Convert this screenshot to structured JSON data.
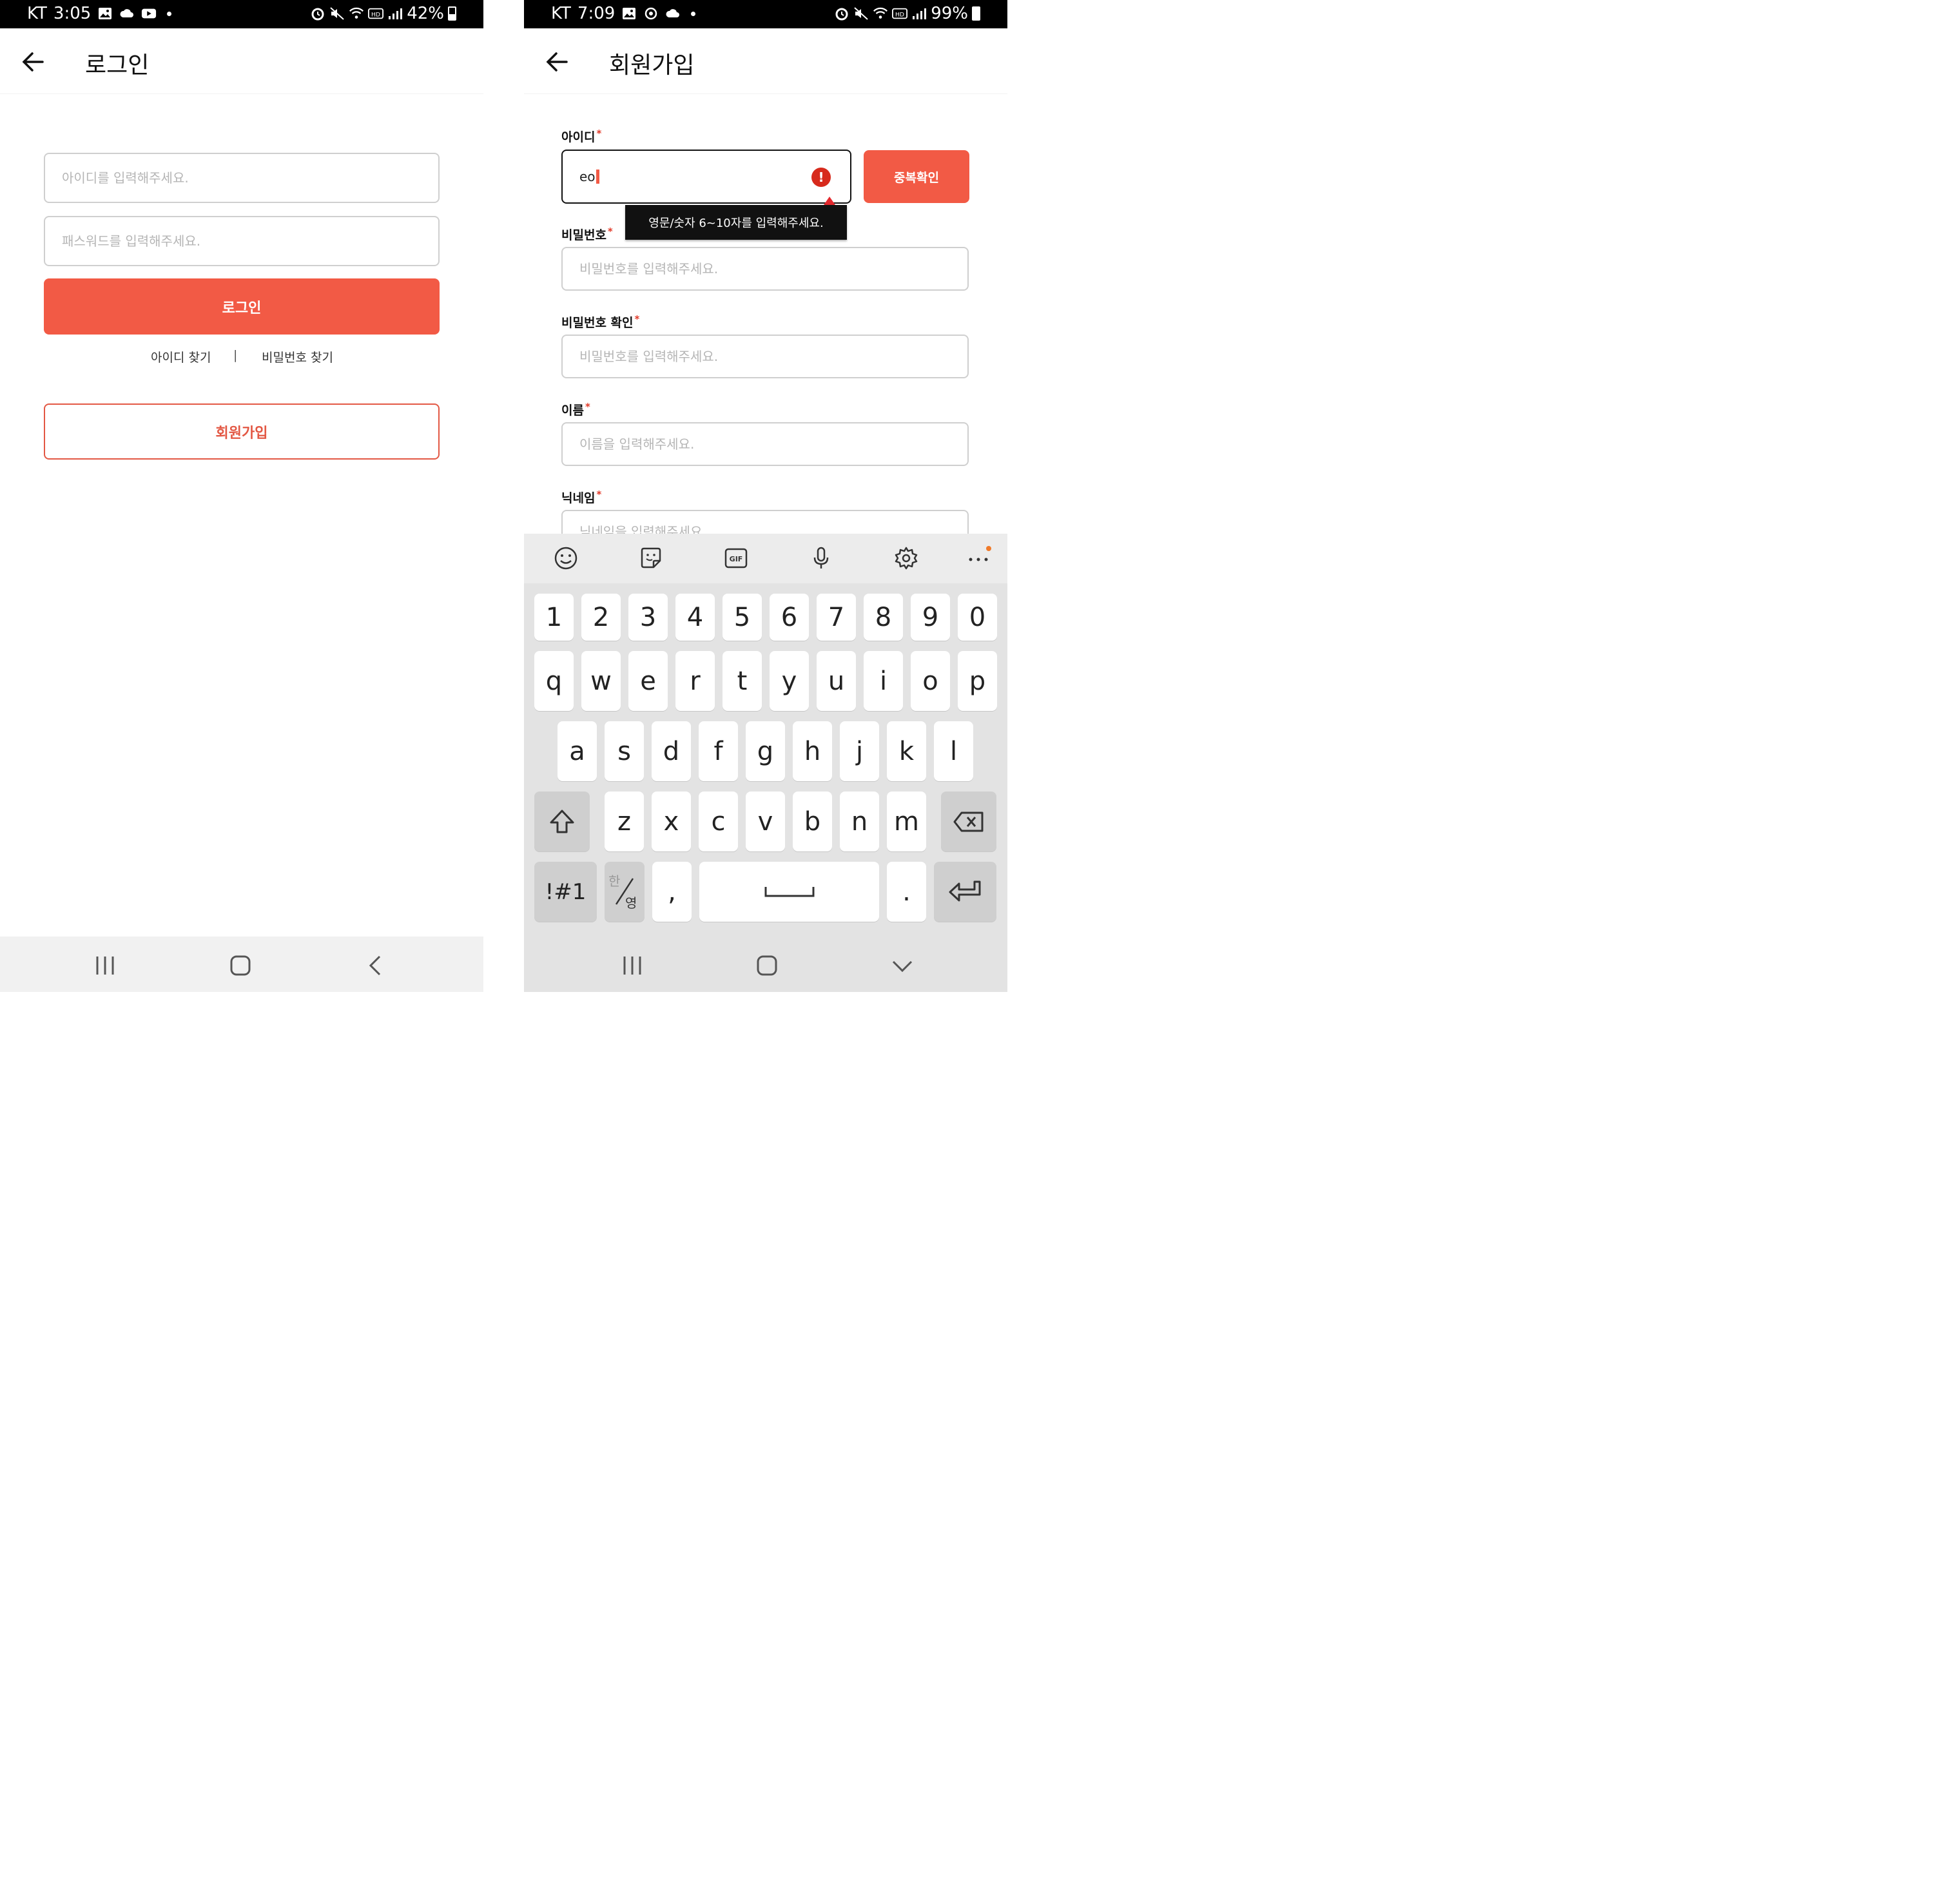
{
  "left": {
    "status": {
      "carrier": "KT",
      "time": "3:05",
      "battery": "42%"
    },
    "appbar": {
      "title": "로그인"
    },
    "login_form": {
      "id_placeholder": "아이디를 입력해주세요.",
      "pw_placeholder": "패스워드를 입력해주세요.",
      "login_label": "로그인",
      "find_id": "아이디 찾기",
      "separator": "|",
      "find_pw": "비밀번호 찾기",
      "signup_label": "회원가입"
    }
  },
  "right": {
    "status": {
      "carrier": "KT",
      "time": "7:09",
      "battery": "99%"
    },
    "appbar": {
      "title": "회원가입"
    },
    "signup_form": {
      "id_label": "아이디",
      "id_value": "eo",
      "dup_check": "중복확인",
      "error_tooltip": "영문/숫자 6~10자를 입력해주세요.",
      "pw_label": "비밀번호",
      "pw_placeholder": "비밀번호를 입력해주세요.",
      "pw_confirm_label": "비밀번호 확인",
      "pw_confirm_placeholder": "비밀번호를 입력해주세요.",
      "name_label": "이름",
      "name_placeholder": "이름을 입력해주세요.",
      "nick_label": "닉네임",
      "nick_placeholder": "닉네임을 입력해주세요.",
      "required_mark": "*"
    },
    "keyboard": {
      "gif_label": "GIF",
      "row_numbers": [
        "1",
        "2",
        "3",
        "4",
        "5",
        "6",
        "7",
        "8",
        "9",
        "0"
      ],
      "row_top": [
        "q",
        "w",
        "e",
        "r",
        "t",
        "y",
        "u",
        "i",
        "o",
        "p"
      ],
      "row_mid": [
        "a",
        "s",
        "d",
        "f",
        "g",
        "h",
        "j",
        "k",
        "l"
      ],
      "row_bottom": [
        "z",
        "x",
        "c",
        "v",
        "b",
        "n",
        "m"
      ],
      "symbols_key": "!#1",
      "lang_key_han": "한",
      "lang_key_eng": "영",
      "comma_key": ",",
      "period_key": "."
    }
  },
  "colors": {
    "accent": "#f25a45",
    "error": "#d72a1c",
    "required": "#e23b2a"
  },
  "icons": [
    "back-arrow-icon",
    "gallery-icon",
    "cloud-icon",
    "youtube-icon",
    "alarm-icon",
    "mute-icon",
    "wifi-icon",
    "hd-icon",
    "signal-icon",
    "battery-icon",
    "emoji-icon",
    "sticker-icon",
    "gif-icon",
    "mic-icon",
    "settings-icon",
    "more-icon",
    "shift-icon",
    "backspace-icon",
    "enter-icon",
    "recents-icon",
    "home-icon",
    "back-nav-icon",
    "hide-keyboard-icon",
    "error-icon"
  ]
}
